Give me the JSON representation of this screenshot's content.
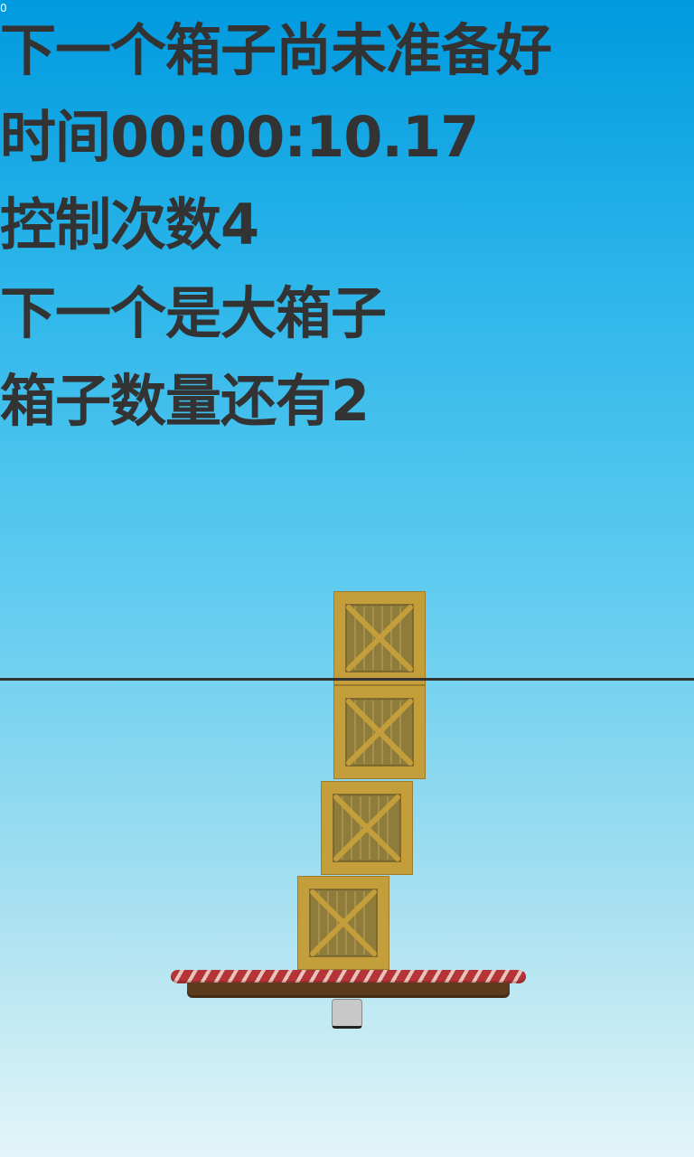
{
  "hud": {
    "fps": "0",
    "status": "下一个箱子尚未准备好",
    "timer": "时间00:00:10.17",
    "control_count": "控制次数4",
    "next_box": "下一个是大箱子",
    "boxes_remaining": "箱子数量还有2"
  },
  "scene": {
    "stacked_crates": 4,
    "colors": {
      "sky_top": "#009ADF",
      "sky_bottom": "#E3F5F8",
      "text": "#333333",
      "crate_frame": "#C49E3A",
      "crate_panel": "#8F7B3A",
      "platform_stripe": "#B53438",
      "platform_base": "#5B3A1E",
      "pivot": "#C8C8C8"
    }
  }
}
